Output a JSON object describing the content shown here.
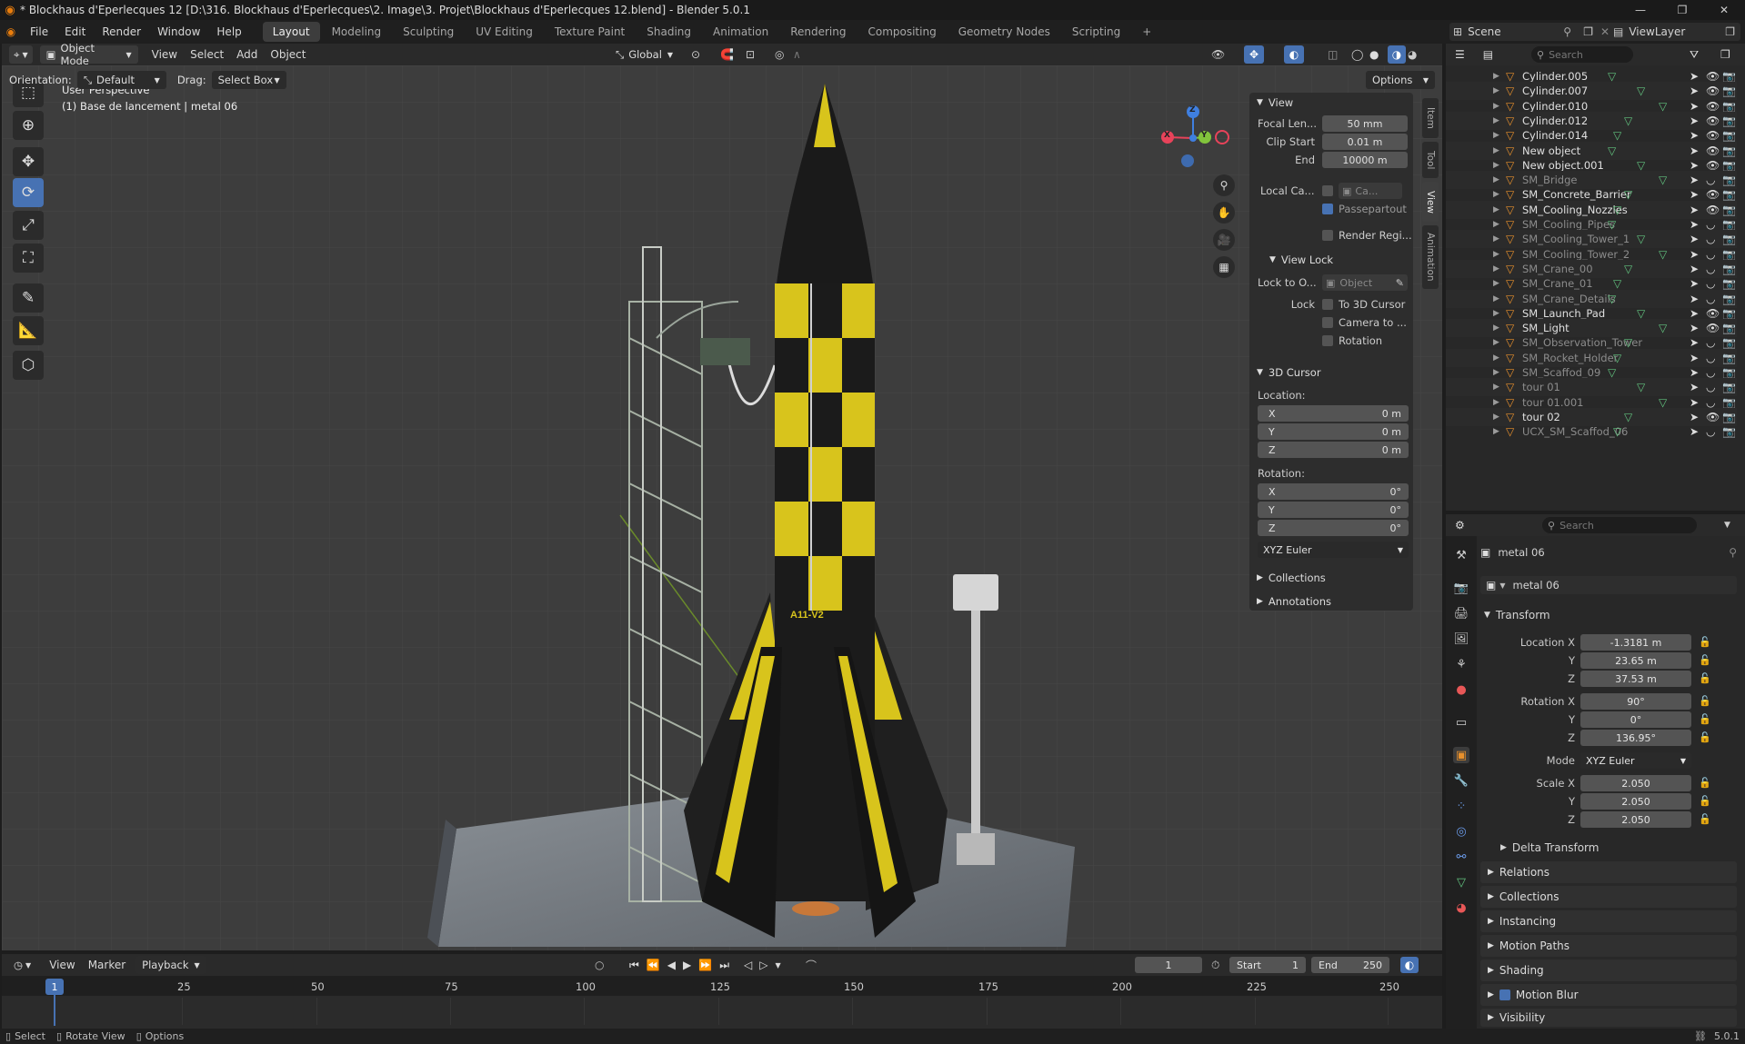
{
  "window": {
    "title": "* Blockhaus d'Eperlecques 12 [D:\\316. Blockhaus d'Eperlecques\\2. Image\\3. Projet\\Blockhaus d'Eperlecques 12.blend] - Blender 5.0.1",
    "min_glyph": "—",
    "max_glyph": "❐",
    "close_glyph": "✕"
  },
  "menu": [
    "File",
    "Edit",
    "Render",
    "Window",
    "Help"
  ],
  "workspaces": [
    "Layout",
    "Modeling",
    "Sculpting",
    "UV Editing",
    "Texture Paint",
    "Shading",
    "Animation",
    "Rendering",
    "Compositing",
    "Geometry Nodes",
    "Scripting"
  ],
  "workspace_active": "Layout",
  "add_workspace": "+",
  "scene": {
    "label": "Scene",
    "viewlayer": "ViewLayer"
  },
  "viewport_header": {
    "mode": "Object Mode",
    "menus": [
      "View",
      "Select",
      "Add",
      "Object"
    ],
    "transform_orientation": "Global",
    "orientation_label": "Orientation:",
    "orientation_value": "Default",
    "drag_label": "Drag:",
    "drag_value": "Select Box",
    "options": "Options"
  },
  "viewport_info": {
    "line1": "User Perspective",
    "line2": "(1) Base de lancement | metal 06"
  },
  "gizmo": {
    "x": "X",
    "y": "Y",
    "z": "Z"
  },
  "sidebar_tabs": [
    "Item",
    "Tool",
    "View",
    "Animation"
  ],
  "npanel": {
    "view_header": "View",
    "focal_label": "Focal Len...",
    "focal_value": "50 mm",
    "clip_start_label": "Clip Start",
    "clip_start_value": "0.01 m",
    "end_label": "End",
    "end_value": "10000 m",
    "local_cam_label": "Local Ca...",
    "local_cam_value": "Ca...",
    "passepartout": "Passepartout",
    "render_region": "Render Regi...",
    "view_lock_header": "View Lock",
    "lock_to_label": "Lock to O...",
    "lock_to_value": "Object",
    "lock_label": "Lock",
    "to_3d_cursor": "To 3D Cursor",
    "camera_to": "Camera to ...",
    "rotation": "Rotation",
    "cursor_header": "3D Cursor",
    "location_label": "Location:",
    "loc_x_label": "X",
    "loc_x": "0 m",
    "loc_y_label": "Y",
    "loc_y": "0 m",
    "loc_z_label": "Z",
    "loc_z": "0 m",
    "rotation_label": "Rotation:",
    "rot_x_label": "X",
    "rot_x": "0°",
    "rot_y_label": "Y",
    "rot_y": "0°",
    "rot_z_label": "Z",
    "rot_z": "0°",
    "rot_mode": "XYZ Euler",
    "collections": "Collections",
    "annotations": "Annotations"
  },
  "rocket_label": "A11-V2",
  "outliner": {
    "search_placeholder": "Search",
    "items": [
      {
        "name": "Cylinder.005",
        "dim": false
      },
      {
        "name": "Cylinder.007",
        "dim": false
      },
      {
        "name": "Cylinder.010",
        "dim": false
      },
      {
        "name": "Cylinder.012",
        "dim": false
      },
      {
        "name": "Cylinder.014",
        "dim": false
      },
      {
        "name": "New object",
        "dim": false
      },
      {
        "name": "New object.001",
        "dim": false
      },
      {
        "name": "SM_Bridge",
        "dim": true
      },
      {
        "name": "SM_Concrete_Barrier",
        "dim": false
      },
      {
        "name": "SM_Cooling_Nozzles",
        "dim": false
      },
      {
        "name": "SM_Cooling_Pipes",
        "dim": true
      },
      {
        "name": "SM_Cooling_Tower_1",
        "dim": true
      },
      {
        "name": "SM_Cooling_Tower_2",
        "dim": true
      },
      {
        "name": "SM_Crane_00",
        "dim": true
      },
      {
        "name": "SM_Crane_01",
        "dim": true
      },
      {
        "name": "SM_Crane_Details",
        "dim": true
      },
      {
        "name": "SM_Launch_Pad",
        "dim": false
      },
      {
        "name": "SM_Light",
        "dim": false
      },
      {
        "name": "SM_Observation_Tower",
        "dim": true
      },
      {
        "name": "SM_Rocket_Holder",
        "dim": true
      },
      {
        "name": "SM_Scaffod_09",
        "dim": true
      },
      {
        "name": "tour 01",
        "dim": true
      },
      {
        "name": "tour 01.001",
        "dim": true
      },
      {
        "name": "tour 02",
        "dim": false
      },
      {
        "name": "UCX_SM_Scaffod_06",
        "dim": true
      }
    ]
  },
  "properties": {
    "search_placeholder": "Search",
    "object_name": "metal 06",
    "datablock_name": "metal 06",
    "transform_header": "Transform",
    "location_x_label": "Location X",
    "location_x": "-1.3181 m",
    "location_y_label": "Y",
    "location_y": "23.65 m",
    "location_z_label": "Z",
    "location_z": "37.53 m",
    "rotation_x_label": "Rotation X",
    "rotation_x": "90°",
    "rotation_y_label": "Y",
    "rotation_y": "0°",
    "rotation_z_label": "Z",
    "rotation_z": "136.95°",
    "mode_label": "Mode",
    "mode_value": "XYZ Euler",
    "scale_x_label": "Scale X",
    "scale_x": "2.050",
    "scale_y_label": "Y",
    "scale_y": "2.050",
    "scale_z_label": "Z",
    "scale_z": "2.050",
    "delta_transform": "Delta Transform",
    "sections": [
      "Relations",
      "Collections",
      "Instancing",
      "Motion Paths",
      "Shading",
      "Motion Blur",
      "Visibility"
    ]
  },
  "timeline": {
    "menus": [
      "View",
      "Marker",
      "Playback"
    ],
    "current_frame": "1",
    "start_label": "Start",
    "start": "1",
    "end_label": "End",
    "end": "250",
    "ticks": [
      "1",
      "25",
      "50",
      "75",
      "100",
      "125",
      "150",
      "175",
      "200",
      "225",
      "250"
    ],
    "playhead": "1"
  },
  "statusbar": {
    "select": "Select",
    "rotate": "Rotate View",
    "options": "Options",
    "version": "5.0.1"
  },
  "colors": {
    "accent": "#4772b3",
    "x_axis": "#e8435a",
    "y_axis": "#82c43c",
    "z_axis": "#3f7fe0",
    "object_orange": "#e8902c",
    "mesh_green": "#62c37f",
    "rocket_yellow": "#d8c41c"
  }
}
